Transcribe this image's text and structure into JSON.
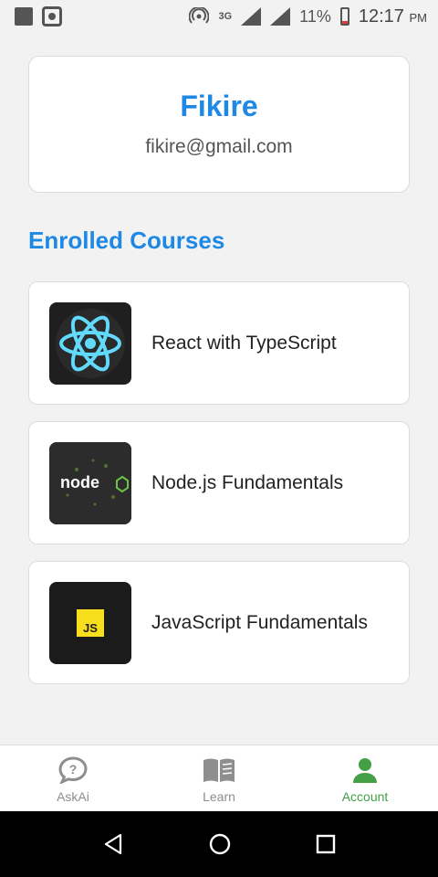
{
  "status_bar": {
    "network": "3G",
    "battery": "11%",
    "time": "12:17",
    "ampm": "PM"
  },
  "profile": {
    "name": "Fikire",
    "email": "fikire@gmail.com"
  },
  "section_title": "Enrolled Courses",
  "courses": [
    {
      "title": "React with TypeScript",
      "thumbnail": "react-logo"
    },
    {
      "title": "Node.js Fundamentals",
      "thumbnail": "nodejs-logo"
    },
    {
      "title": "JavaScript Fundamentals",
      "thumbnail": "js-logo"
    }
  ],
  "bottom_nav": [
    {
      "label": "AskAi",
      "icon": "question-bubble-icon"
    },
    {
      "label": "Learn",
      "icon": "book-icon"
    },
    {
      "label": "Account",
      "icon": "person-icon",
      "active": true
    }
  ],
  "colors": {
    "accent": "#1e88e5",
    "active_tab": "#43a047"
  }
}
